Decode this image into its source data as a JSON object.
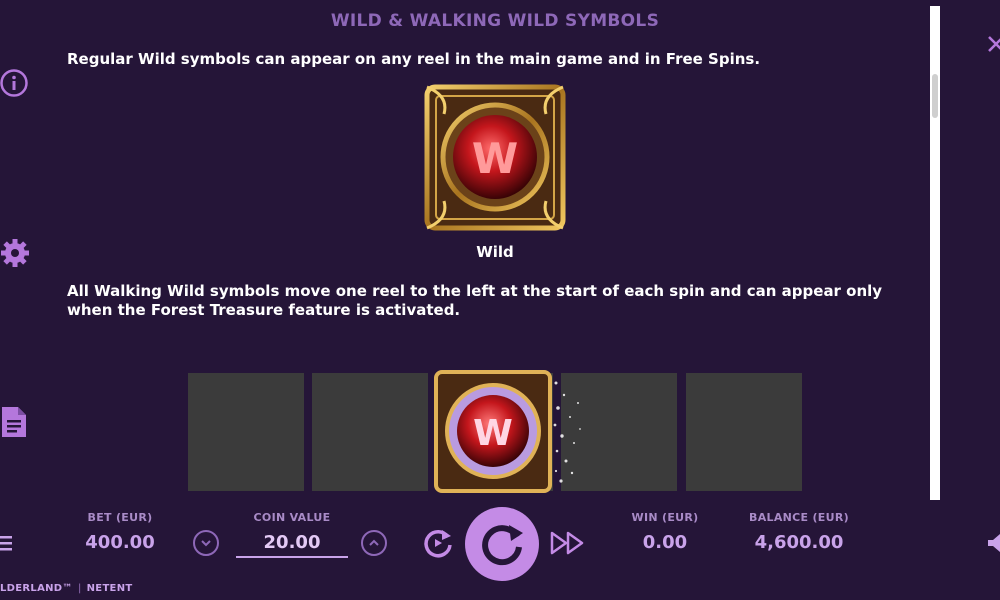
{
  "header": {
    "title": "WILD & WALKING WILD SYMBOLS"
  },
  "content": {
    "paragraph1": "Regular Wild symbols can appear on any reel in the main game and in Free Spins.",
    "wild_symbol": {
      "icon": "wild-w-icon",
      "letter": "W",
      "label": "Wild"
    },
    "paragraph2": "All Walking Wild symbols move one reel to the left at the start of each spin and can appear only when the Forest Treasure feature is activated.",
    "walking_wild": {
      "icon": "walking-wild-w-icon",
      "letter": "W"
    }
  },
  "sidebar": {
    "icons": [
      "info-icon",
      "gear-icon",
      "document-icon"
    ],
    "close_icon": "close-icon"
  },
  "bottom_bar": {
    "bet": {
      "label": "BET (EUR)",
      "value": "400.00"
    },
    "coin_value": {
      "label": "COIN VALUE",
      "value": "20.00"
    },
    "win": {
      "label": "WIN (EUR)",
      "value": "0.00"
    },
    "balance": {
      "label": "BALANCE (EUR)",
      "value": "4,600.00"
    },
    "icons": [
      "menu-icon",
      "chevron-down-icon",
      "chevron-up-icon",
      "autoplay-icon",
      "spin-icon",
      "turbo-icon",
      "sound-icon"
    ]
  },
  "footer": {
    "game": "LDERLAND™",
    "brand": "NETENT"
  },
  "colors": {
    "background": "#251538",
    "accent": "#c48be6",
    "muted": "#8e68b8",
    "gold": "#d4a547",
    "red": "#c4161c"
  }
}
